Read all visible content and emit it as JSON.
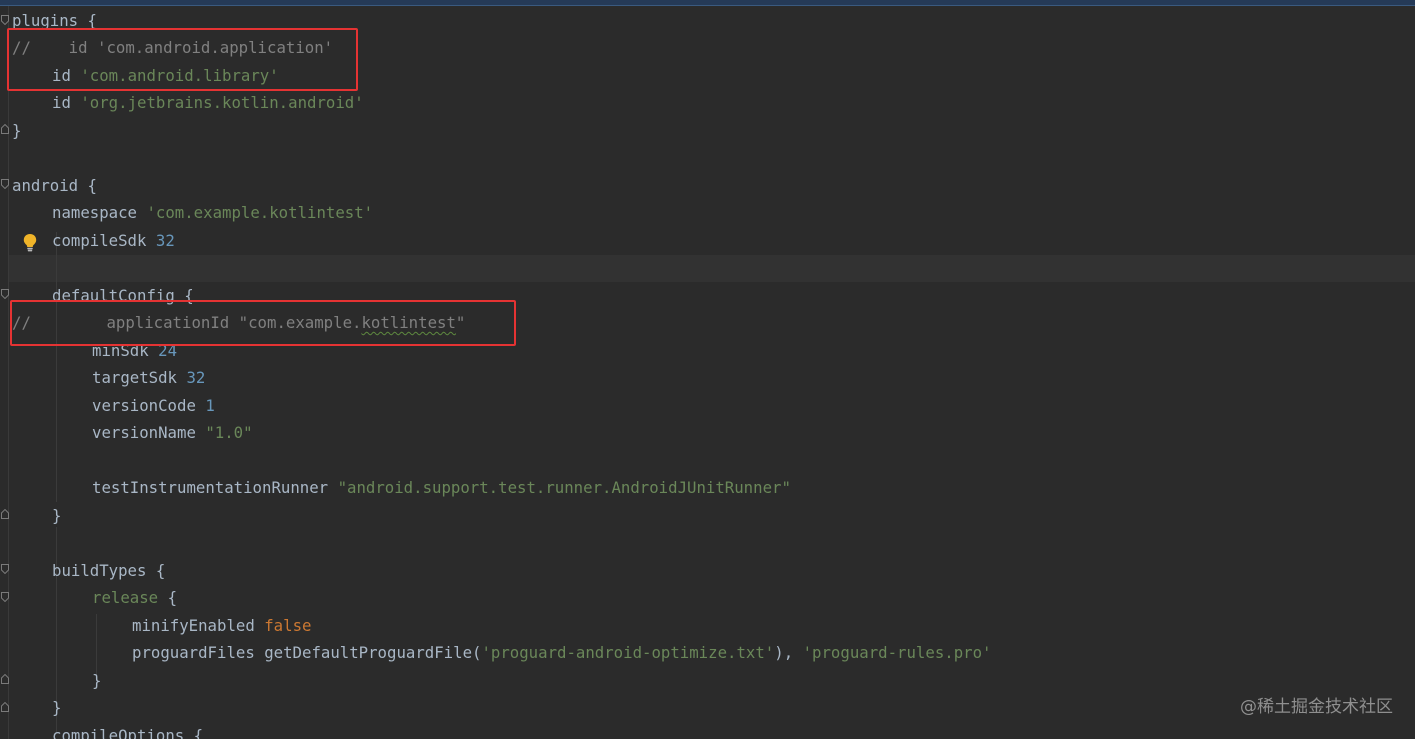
{
  "editor": {
    "lines": [
      {
        "indent": 0,
        "tokens": [
          {
            "t": "plugins {",
            "c": "fn"
          }
        ]
      },
      {
        "indent": 0,
        "tokens": [
          {
            "t": "//    id 'com.android.application'",
            "c": "cmt"
          }
        ]
      },
      {
        "indent": 4,
        "tokens": [
          {
            "t": "id ",
            "c": "fn"
          },
          {
            "t": "'com.android.library'",
            "c": "str"
          }
        ]
      },
      {
        "indent": 4,
        "tokens": [
          {
            "t": "id ",
            "c": "fn"
          },
          {
            "t": "'org.jetbrains.kotlin.android'",
            "c": "str"
          }
        ]
      },
      {
        "indent": 0,
        "tokens": [
          {
            "t": "}",
            "c": "fn"
          }
        ]
      },
      {
        "indent": 0,
        "tokens": []
      },
      {
        "indent": 0,
        "tokens": [
          {
            "t": "android {",
            "c": "fn"
          }
        ]
      },
      {
        "indent": 4,
        "tokens": [
          {
            "t": "namespace ",
            "c": "fn"
          },
          {
            "t": "'com.example.kotlintest'",
            "c": "str"
          }
        ]
      },
      {
        "indent": 4,
        "tokens": [
          {
            "t": "compileSdk ",
            "c": "fn"
          },
          {
            "t": "32",
            "c": "num"
          }
        ]
      },
      {
        "indent": 0,
        "tokens": []
      },
      {
        "indent": 4,
        "tokens": [
          {
            "t": "defaultConfig {",
            "c": "fn"
          }
        ]
      },
      {
        "indent": 0,
        "tokens": [
          {
            "t": "//        applicationId \"com.example.",
            "c": "cmt"
          },
          {
            "t": "kotlintest",
            "c": "cmt typo"
          },
          {
            "t": "\"",
            "c": "cmt"
          }
        ]
      },
      {
        "indent": 8,
        "tokens": [
          {
            "t": "minSdk ",
            "c": "fn"
          },
          {
            "t": "24",
            "c": "num"
          }
        ]
      },
      {
        "indent": 8,
        "tokens": [
          {
            "t": "targetSdk ",
            "c": "fn"
          },
          {
            "t": "32",
            "c": "num"
          }
        ]
      },
      {
        "indent": 8,
        "tokens": [
          {
            "t": "versionCode ",
            "c": "fn"
          },
          {
            "t": "1",
            "c": "num"
          }
        ]
      },
      {
        "indent": 8,
        "tokens": [
          {
            "t": "versionName ",
            "c": "fn"
          },
          {
            "t": "\"1.0\"",
            "c": "str"
          }
        ]
      },
      {
        "indent": 0,
        "tokens": []
      },
      {
        "indent": 8,
        "tokens": [
          {
            "t": "testInstrumentationRunner ",
            "c": "fn"
          },
          {
            "t": "\"android.support.test.runner.AndroidJUnitRunner\"",
            "c": "str"
          }
        ]
      },
      {
        "indent": 4,
        "tokens": [
          {
            "t": "}",
            "c": "fn"
          }
        ]
      },
      {
        "indent": 0,
        "tokens": []
      },
      {
        "indent": 4,
        "tokens": [
          {
            "t": "buildTypes {",
            "c": "fn"
          }
        ]
      },
      {
        "indent": 8,
        "tokens": [
          {
            "t": "release",
            "c": "str"
          },
          {
            "t": " {",
            "c": "fn"
          }
        ]
      },
      {
        "indent": 12,
        "tokens": [
          {
            "t": "minifyEnabled ",
            "c": "fn"
          },
          {
            "t": "false",
            "c": "kw"
          }
        ]
      },
      {
        "indent": 12,
        "tokens": [
          {
            "t": "proguardFiles getDefaultProguardFile(",
            "c": "fn"
          },
          {
            "t": "'proguard-android-optimize.txt'",
            "c": "str"
          },
          {
            "t": "), ",
            "c": "fn"
          },
          {
            "t": "'proguard-rules.pro'",
            "c": "str"
          }
        ]
      },
      {
        "indent": 8,
        "tokens": [
          {
            "t": "}",
            "c": "fn"
          }
        ]
      },
      {
        "indent": 4,
        "tokens": [
          {
            "t": "}",
            "c": "fn"
          }
        ]
      },
      {
        "indent": 4,
        "tokens": [
          {
            "t": "compileOptions {",
            "c": "fn"
          }
        ]
      }
    ]
  },
  "watermark": "@稀土掘金技术社区",
  "colors": {
    "background": "#2b2b2b",
    "default_text": "#a9b7c6",
    "keyword": "#cc7832",
    "string": "#6a8759",
    "number": "#6897bb",
    "comment": "#808080",
    "highlight_box": "#e53333",
    "bulb": "#f0b429"
  },
  "icons": {
    "fold_markers": "fold-marker-icon",
    "intention": "lightbulb-icon"
  }
}
